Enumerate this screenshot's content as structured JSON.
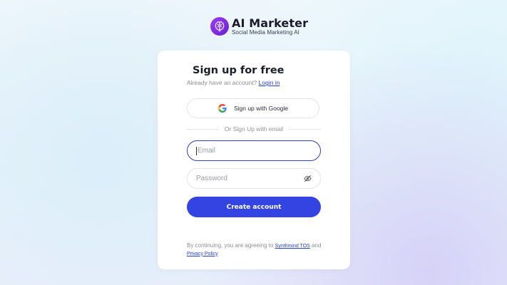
{
  "brand": {
    "name": "AI Marketer",
    "tagline": "Social Media Marketing AI",
    "icon": "brain-icon",
    "color": "#7b2de0"
  },
  "signup": {
    "title": "Sign up for free",
    "already_text": "Already have an account?",
    "login_link": "Login in",
    "google_button": "Sign up with Google",
    "divider_text": "Or Sign Up with email",
    "email_placeholder": "Email",
    "password_placeholder": "Password",
    "create_button": "Create account",
    "accent_color": "#3344e3"
  },
  "terms": {
    "prefix": "By continuing, you are agreeing to",
    "tos_link": "Synthmind TOS",
    "and": "and",
    "privacy_link": "Privacy Policy"
  }
}
